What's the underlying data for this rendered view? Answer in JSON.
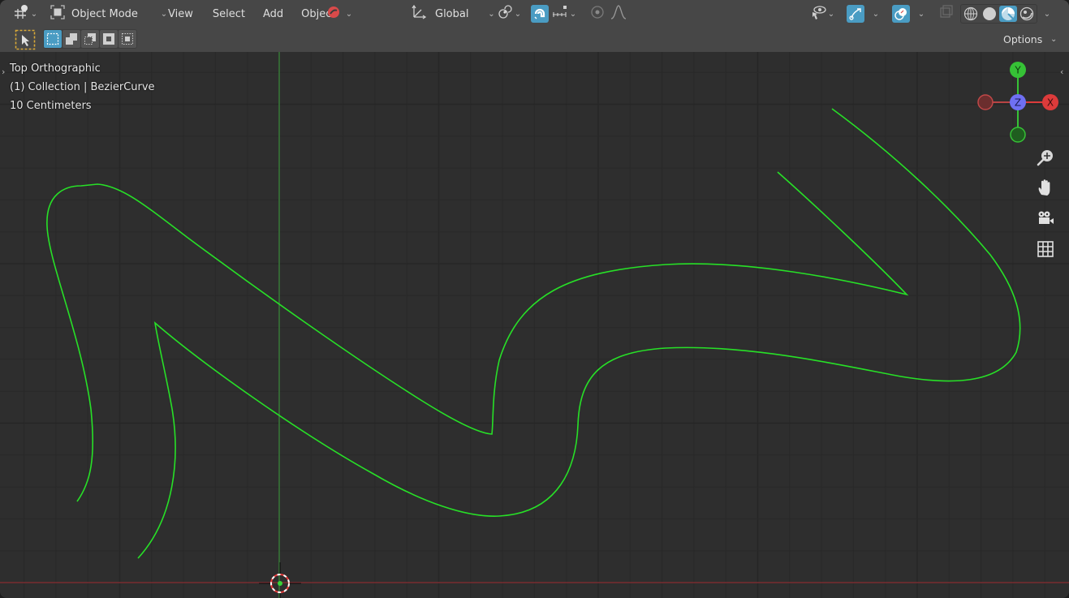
{
  "header": {
    "editor_type_icon": "3d-viewport-icon",
    "mode_label": "Object Mode",
    "menus": [
      "View",
      "Select",
      "Add",
      "Object"
    ],
    "transform_orientation": "Global",
    "options_label": "Options"
  },
  "toolbar": {
    "tool": "select-box",
    "select_modes": [
      "set-new",
      "extend",
      "subtract",
      "invert",
      "intersect"
    ],
    "active_select_mode": "set-new"
  },
  "viewport": {
    "view_name": "Top Orthographic",
    "collection_info": "(1) Collection | BezierCurve",
    "scale_info": "10 Centimeters",
    "gizmo": {
      "y_label": "Y",
      "z_label": "Z",
      "x_label": "X",
      "colors": {
        "x": "#dd3b3b",
        "y": "#36c236",
        "z": "#6f70f3"
      }
    },
    "curve_color": "#27e027",
    "navigation_tools": [
      "zoom-icon",
      "pan-hand-icon",
      "camera-icon",
      "grid-icon"
    ]
  },
  "shading": {
    "modes": [
      "wireframe",
      "solid",
      "material-preview",
      "rendered"
    ],
    "active": "material-preview"
  }
}
